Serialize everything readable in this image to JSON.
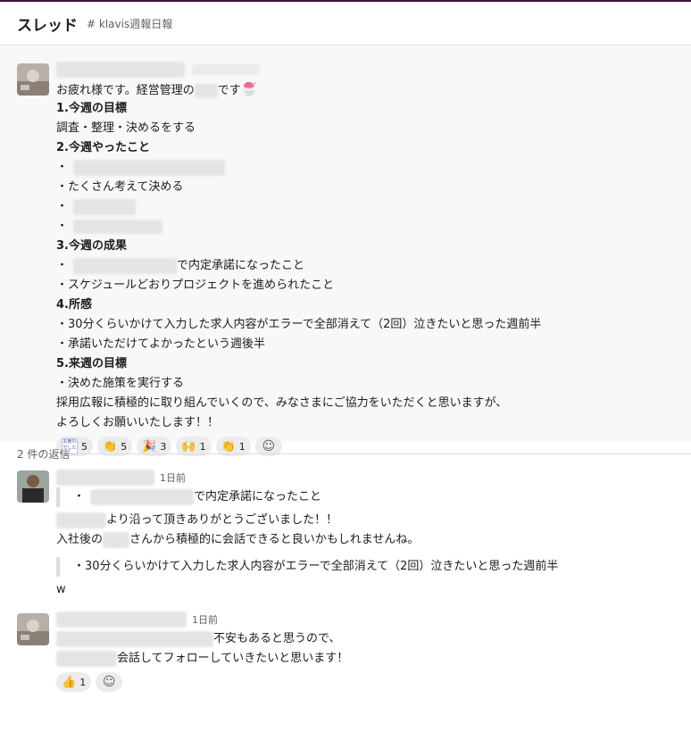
{
  "header": {
    "title": "スレッド",
    "channel": "# klavis週報日報"
  },
  "parent": {
    "greeting": "お疲れ様です。経営管理の",
    "greeting_suffix": "です",
    "lines": [
      {
        "text": "1.今週の目標",
        "bold": true
      },
      {
        "text": "調査・整理・決めるをする"
      },
      {
        "text": "2.今週やったこと",
        "bold": true
      },
      {
        "text": "・"
      },
      {
        "text": "・たくさん考えて決める"
      },
      {
        "text": "・"
      },
      {
        "text": "・"
      },
      {
        "text": "3.今週の成果",
        "bold": true
      },
      {
        "text": "で内定承諾になったこと"
      },
      {
        "text": "・スケジュールどおりプロジェクトを進められたこと"
      },
      {
        "text": "4.所感",
        "bold": true
      },
      {
        "text": "・30分くらいかけて入力した求人内容がエラーで全部消えて（2回）泣きたいと思った週前半"
      },
      {
        "text": "・承諾いただけてよかったという週後半"
      },
      {
        "text": "5.来週の目標",
        "bold": true
      },
      {
        "text": "・決めた施策を実行する"
      },
      {
        "text": "採用広報に積極的に取り組んでいくので、みなさまにご協力をいただくと思いますが、"
      },
      {
        "text": "よろしくお願いいたします！！"
      }
    ],
    "reactions": [
      {
        "emoji": "お疲れ様でした",
        "count": "5",
        "color": "#6a5acd"
      },
      {
        "emoji": "👏",
        "count": "5",
        "color": "#e0b040"
      },
      {
        "emoji": "🎉",
        "count": "3",
        "color": "#e07030"
      },
      {
        "emoji": "🙌",
        "count": "1",
        "color": "#e0a030"
      },
      {
        "emoji": "👏",
        "count": "1",
        "color": "#e0b040"
      }
    ]
  },
  "replies_label": "2 件の返信",
  "reply1": {
    "time": "1日前",
    "quote1_prefix": "・",
    "quote1_suffix": "で内定承諾になったこと",
    "line1_suffix": "より沿って頂きありがとうございました！！",
    "line2_prefix": "入社後の",
    "line2_suffix": "さんから積極的に会話できると良いかもしれませんね。",
    "quote2": "・30分くらいかけて入力した求人内容がエラーで全部消えて（2回）泣きたいと思った週前半",
    "line3": "w"
  },
  "reply2": {
    "time": "1日前",
    "line1_suffix": "不安もあると思うので、",
    "line2_suffix": "会話してフォローしていきたいと思います！",
    "reaction": {
      "emoji": "👍",
      "count": "1"
    }
  }
}
